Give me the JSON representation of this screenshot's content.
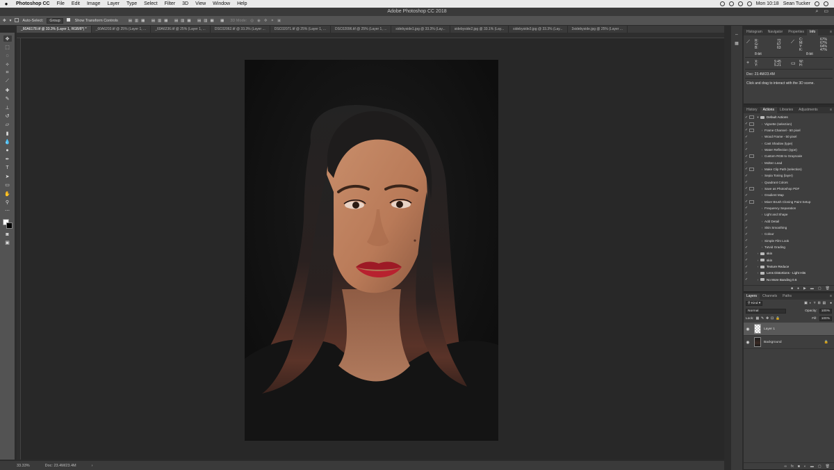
{
  "menubar": {
    "apple": "",
    "app": "Photoshop CC",
    "items": [
      "File",
      "Edit",
      "Image",
      "Layer",
      "Type",
      "Select",
      "Filter",
      "3D",
      "View",
      "Window",
      "Help"
    ],
    "time": "Mon 10:18",
    "user": "Sean Tucker"
  },
  "titlebar": {
    "title": "Adobe Photoshop CC 2018"
  },
  "options": {
    "auto_select_label": "Auto-Select:",
    "auto_select_value": "Group",
    "transform_label": "Show Transform Controls",
    "mode3d_label": "3D Mode:"
  },
  "tabs": [
    "_60A6178.tif @ 33.3% (Layer 1, RGB/8*) *",
    "_60A6203.tif @ 25% (Layer 1, ...",
    "_60A6236.tif @ 25% (Layer 1, ...",
    "DSC02062.tif @ 33.3% (Layer ...",
    "DSC02071.tif @ 25% (Layer 1, ...",
    "DSC02096.tif @ 25% (Layer 1, ...",
    "sidebyside1.jpg @ 33.3% (Lay...",
    "sidebyside2.jpg @ 33.1% (Lay...",
    "sidebyside3.jpg @ 33.3% (Lay...",
    "3sidebyside.jpg @ 25% (Layer ..."
  ],
  "status": {
    "zoom": "33.33%",
    "doc": "Doc: 23.4M/23.4M"
  },
  "info_panel": {
    "tabs": [
      "Histogram",
      "Navigator",
      "Properties",
      "Info"
    ],
    "rgb": {
      "r_label": "R:",
      "g_label": "G:",
      "b_label": "B:",
      "r": "72",
      "g": "67",
      "b": "63"
    },
    "cmyk": {
      "c_label": "C:",
      "m_label": "M:",
      "y_label": "Y:",
      "k_label": "K:",
      "c": "67%",
      "m": "67%",
      "y": "64%",
      "k": "47%"
    },
    "bit_left": "8-bit",
    "bit_right": "8-bit",
    "xy": {
      "x_label": "X:",
      "y_label": "Y:",
      "x": "9.45",
      "y": "5.21"
    },
    "wh": {
      "w_label": "W:",
      "h_label": "H:"
    },
    "doc": "Doc: 23.4M/23.4M",
    "hint": "Click and drag to interact with the 3D scene."
  },
  "actions_panel": {
    "tabs": [
      "History",
      "Actions",
      "Libraries",
      "Adjustments"
    ],
    "items": [
      {
        "label": "Default Actions",
        "set": true,
        "dlg": true,
        "expanded": true
      },
      {
        "label": "Vignette (selection)",
        "set": false,
        "dlg": true
      },
      {
        "label": "Frame Channel - 50 pixel",
        "set": false,
        "dlg": true
      },
      {
        "label": "Wood Frame - 50 pixel",
        "set": false,
        "dlg": false
      },
      {
        "label": "Cast Shadow (type)",
        "set": false,
        "dlg": false
      },
      {
        "label": "Water Reflection (type)",
        "set": false,
        "dlg": false
      },
      {
        "label": "Custom RGB to Grayscale",
        "set": false,
        "dlg": true
      },
      {
        "label": "Molten Lead",
        "set": false,
        "dlg": false
      },
      {
        "label": "Make Clip Path (selection)",
        "set": false,
        "dlg": true
      },
      {
        "label": "Sepia Toning (layer)",
        "set": false,
        "dlg": false
      },
      {
        "label": "Quadrant Colors",
        "set": false,
        "dlg": false
      },
      {
        "label": "Save as Photoshop PDF",
        "set": false,
        "dlg": true
      },
      {
        "label": "Gradient Map",
        "set": false,
        "dlg": false
      },
      {
        "label": "Mixer Brush Cloning Paint Setup",
        "set": false,
        "dlg": true
      },
      {
        "label": "Frequency Separation",
        "set": false,
        "dlg": false
      },
      {
        "label": "Light and Shape",
        "set": false,
        "dlg": false
      },
      {
        "label": "Add Detail",
        "set": false,
        "dlg": false
      },
      {
        "label": "Skin Smoothing",
        "set": false,
        "dlg": false
      },
      {
        "label": "Colour",
        "set": false,
        "dlg": false
      },
      {
        "label": "Simple Film Look",
        "set": false,
        "dlg": false
      },
      {
        "label": "Tutvid Grading",
        "set": false,
        "dlg": false
      },
      {
        "label": "skin",
        "set": true,
        "dlg": false
      },
      {
        "label": "skin",
        "set": true,
        "dlg": false
      },
      {
        "label": "Texture Reduce",
        "set": true,
        "dlg": false
      },
      {
        "label": "Lens Distortions - Light Hits",
        "set": true,
        "dlg": false
      },
      {
        "label": "No More Banding 0.6",
        "set": true,
        "dlg": false
      }
    ]
  },
  "layers_panel": {
    "tabs": [
      "Layers",
      "Channels",
      "Paths"
    ],
    "filter": "Kind",
    "blend": "Normal",
    "opacity_label": "Opacity:",
    "opacity": "100%",
    "lock_label": "Lock:",
    "fill_label": "Fill:",
    "fill": "100%",
    "layers": [
      {
        "name": "Layer 1",
        "selected": true,
        "thumb": "transparent"
      },
      {
        "name": "Background",
        "selected": false,
        "thumb": "image",
        "locked": true
      }
    ]
  }
}
